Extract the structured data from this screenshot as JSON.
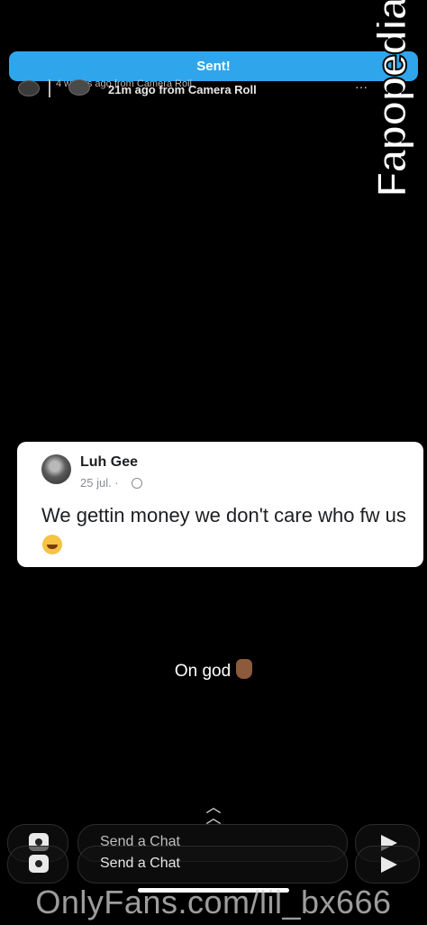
{
  "status_banner": {
    "text": "Sent!"
  },
  "story_header": {
    "faded_meta": "4 weeks ago from Camera Roll",
    "main_meta": "21m ago from Camera Roll",
    "more_icon": "ellipsis-icon"
  },
  "watermarks": {
    "side": "Fapopedia",
    "bottom": "OnlyFans.com/lil_bx666"
  },
  "post_card": {
    "author": "Luh Gee",
    "date": "25 jul. ·",
    "text": "We gettin money we don't care who fw us",
    "emoji": "laughing-tears-emoji",
    "privacy_icon": "globe-icon"
  },
  "caption": {
    "text": "On god",
    "emoji": "victory-hand-emoji"
  },
  "chat_bar": {
    "placeholder": "Send a Chat",
    "camera_icon": "camera-icon",
    "send_icon": "send-arrow-icon",
    "swipe_up_icon": "chevron-up-icon"
  }
}
